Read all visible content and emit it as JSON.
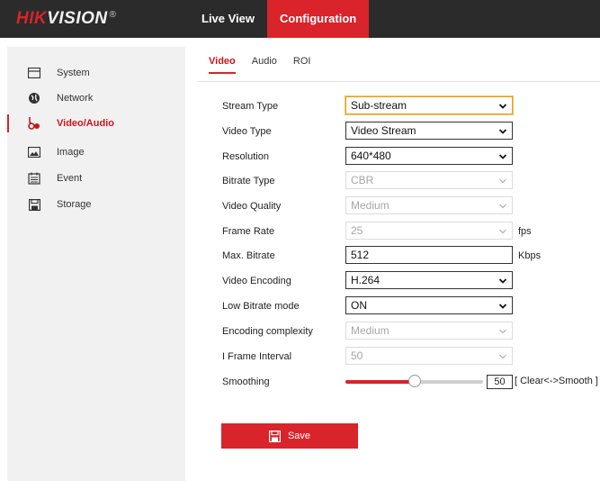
{
  "header": {
    "logo_left": "HIK",
    "logo_right": "VISION",
    "logo_reg": "®",
    "nav": [
      {
        "label": "Live View",
        "active": false
      },
      {
        "label": "Configuration",
        "active": true
      }
    ]
  },
  "sidebar": {
    "items": [
      {
        "label": "System",
        "icon": "monitor-icon",
        "active": false
      },
      {
        "label": "Network",
        "icon": "globe-icon",
        "active": false
      },
      {
        "label": "Video/Audio",
        "icon": "video-audio-icon",
        "active": true
      },
      {
        "label": "Image",
        "icon": "image-icon",
        "active": false
      },
      {
        "label": "Event",
        "icon": "calendar-icon",
        "active": false
      },
      {
        "label": "Storage",
        "icon": "save-disk-icon",
        "active": false
      }
    ]
  },
  "tabs": [
    {
      "label": "Video",
      "active": true
    },
    {
      "label": "Audio",
      "active": false
    },
    {
      "label": "ROI",
      "active": false
    }
  ],
  "form": {
    "stream_type": {
      "label": "Stream Type",
      "value": "Sub-stream"
    },
    "video_type": {
      "label": "Video Type",
      "value": "Video Stream"
    },
    "resolution": {
      "label": "Resolution",
      "value": "640*480"
    },
    "bitrate_type": {
      "label": "Bitrate Type",
      "value": "CBR"
    },
    "video_quality": {
      "label": "Video Quality",
      "value": "Medium"
    },
    "frame_rate": {
      "label": "Frame Rate",
      "value": "25",
      "unit": "fps"
    },
    "max_bitrate": {
      "label": "Max. Bitrate",
      "value": "512",
      "unit": "Kbps"
    },
    "video_encoding": {
      "label": "Video Encoding",
      "value": "H.264"
    },
    "low_bitrate_mode": {
      "label": "Low Bitrate mode",
      "value": "ON"
    },
    "encoding_complexity": {
      "label": "Encoding complexity",
      "value": "Medium"
    },
    "i_frame_interval": {
      "label": "I Frame Interval",
      "value": "50"
    },
    "smoothing": {
      "label": "Smoothing",
      "value": "50",
      "hint": "[ Clear<->Smooth ]"
    }
  },
  "save_label": "Save",
  "colors": {
    "accent": "#d8242a",
    "header_bg": "#2b2b2b",
    "sidebar_bg": "#f1f1f1"
  }
}
